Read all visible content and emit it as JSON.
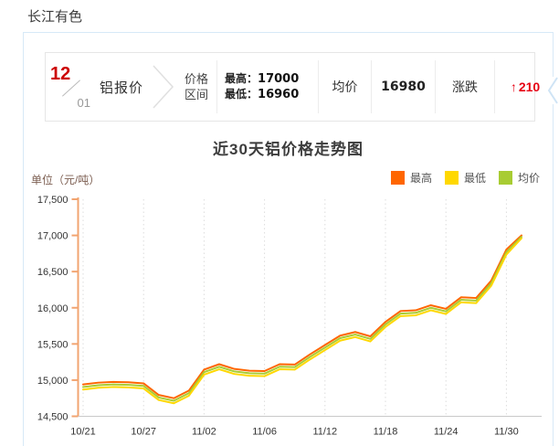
{
  "page": {
    "title": "长江有色"
  },
  "quote_bar": {
    "date_month": "12",
    "date_day": "01",
    "product": "铝报价",
    "range_label_line1": "价格",
    "range_label_line2": "区间",
    "high_label": "最高：",
    "high_value": "17000",
    "low_label": "最低：",
    "low_value": "16960",
    "avg_label": "均价",
    "avg_value": "16980",
    "change_label": "涨跌",
    "change_arrow": "↑",
    "change_value": "210"
  },
  "chart": {
    "title": "近30天铝价格走势图",
    "unit_label": "单位（元/吨）",
    "legend": [
      {
        "label": "最高",
        "color": "#ff6600"
      },
      {
        "label": "最低",
        "color": "#ffd800"
      },
      {
        "label": "均价",
        "color": "#a8cc33"
      }
    ],
    "colors": {
      "y_axis": "#f2a470",
      "x_axis": "#c9c9c9",
      "gridline": "#dcdcdc",
      "accent_red": "#c00",
      "change_red": "#e60012",
      "panel_border": "#d7e9f7"
    }
  },
  "chart_data": {
    "type": "line",
    "title": "近30天铝价格走势图",
    "ylabel": "单位（元/吨）",
    "ylim": [
      14500,
      17500
    ],
    "yticks": [
      17500,
      17000,
      16500,
      16000,
      15500,
      15000,
      14500
    ],
    "ytick_labels": [
      "17,500",
      "17,000",
      "16,500",
      "16,000",
      "15,500",
      "15,000",
      "14,500"
    ],
    "x_labels": [
      "10/21",
      "10/27",
      "11/02",
      "11/06",
      "11/12",
      "11/18",
      "11/24",
      "11/30"
    ],
    "x_label_indices": [
      0,
      4,
      8,
      12,
      16,
      20,
      24,
      28
    ],
    "grid": "vertical-dotted",
    "legend_position": "top-right",
    "series": [
      {
        "name": "最高",
        "color": "#ff6600",
        "values": [
          14940,
          14965,
          14975,
          14970,
          14955,
          14795,
          14750,
          14855,
          15145,
          15220,
          15155,
          15130,
          15125,
          15220,
          15215,
          15355,
          15485,
          15615,
          15665,
          15605,
          15805,
          15955,
          15965,
          16035,
          15985,
          16145,
          16135,
          16375,
          16805,
          17000
        ]
      },
      {
        "name": "均价",
        "color": "#a8cc33",
        "values": [
          14905,
          14930,
          14940,
          14935,
          14920,
          14760,
          14715,
          14820,
          15110,
          15185,
          15120,
          15095,
          15090,
          15185,
          15180,
          15320,
          15450,
          15580,
          15630,
          15570,
          15770,
          15920,
          15930,
          16000,
          15950,
          16110,
          16100,
          16340,
          16770,
          16980
        ]
      },
      {
        "name": "最低",
        "color": "#ffd800",
        "values": [
          14870,
          14895,
          14905,
          14900,
          14885,
          14725,
          14680,
          14785,
          15075,
          15150,
          15085,
          15060,
          15055,
          15150,
          15145,
          15285,
          15415,
          15545,
          15595,
          15535,
          15735,
          15885,
          15895,
          15965,
          15915,
          16075,
          16065,
          16305,
          16735,
          16960
        ]
      }
    ]
  }
}
